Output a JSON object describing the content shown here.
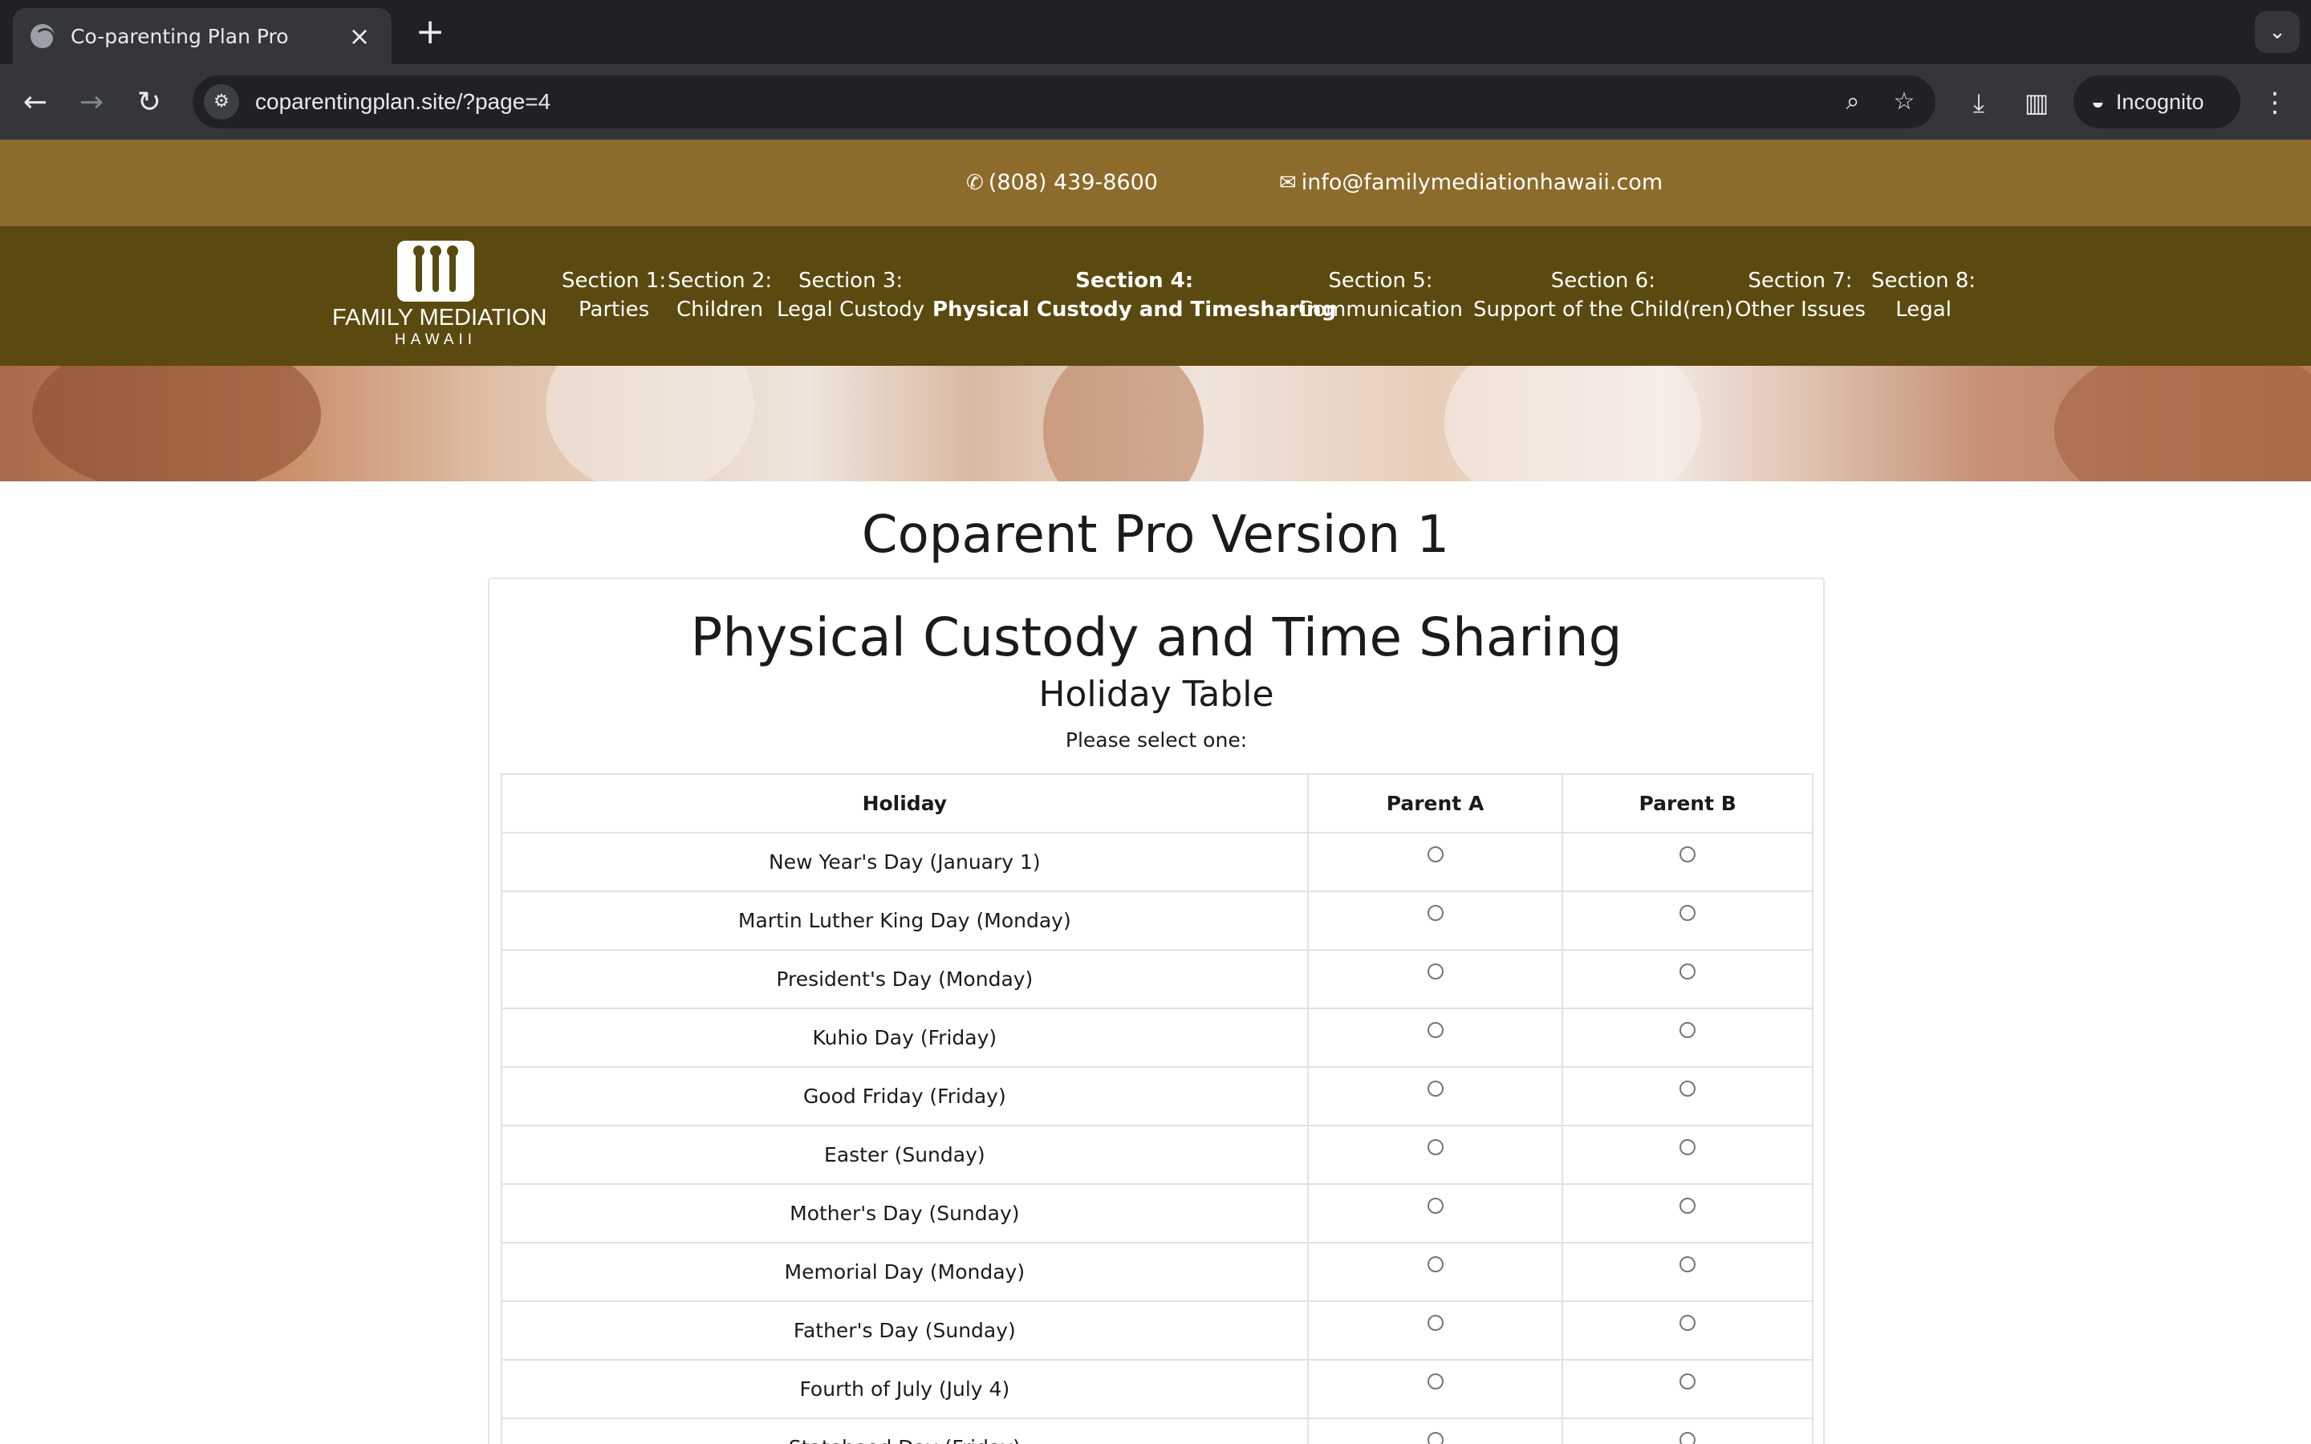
{
  "browser": {
    "tab_title": "Co-parenting Plan Pro",
    "url": "coparentingplan.site/?page=4",
    "incognito_label": "Incognito",
    "icons": [
      "globe-icon",
      "close-icon",
      "plus-icon",
      "chevron-down-icon",
      "back-icon",
      "forward-icon",
      "reload-icon",
      "site-info-icon",
      "zoom-icon",
      "star-icon",
      "download-icon",
      "sidepanel-icon",
      "incognito-icon",
      "kebab-menu-icon"
    ]
  },
  "contact": {
    "phone": "(808) 439-8600",
    "email": "info@familymediationhawaii.com"
  },
  "logo": {
    "line1": "FAMILY MEDIATION",
    "line2": "HAWAII"
  },
  "nav": [
    {
      "line1": "Section 1:",
      "line2": "Parties"
    },
    {
      "line1": "Section 2:",
      "line2": "Children"
    },
    {
      "line1": "Section 3:",
      "line2": "Legal Custody"
    },
    {
      "line1": "Section 4:",
      "line2": "Physical Custody and Timesharing",
      "active": true
    },
    {
      "line1": "Section 5:",
      "line2": "Communication"
    },
    {
      "line1": "Section 6:",
      "line2": "Support of the Child(ren)"
    },
    {
      "line1": "Section 7:",
      "line2": "Other Issues"
    },
    {
      "line1": "Section 8:",
      "line2": "Legal"
    }
  ],
  "page": {
    "title": "Coparent Pro Version 1",
    "section_title": "Physical Custody and Time Sharing",
    "subtitle": "Holiday Table",
    "instruction": "Please select one:"
  },
  "table": {
    "headers": [
      "Holiday",
      "Parent A",
      "Parent B"
    ],
    "rows": [
      "New Year's Day (January 1)",
      "Martin Luther King Day (Monday)",
      "President's Day (Monday)",
      "Kuhio Day (Friday)",
      "Good Friday (Friday)",
      "Easter (Sunday)",
      "Mother's Day (Sunday)",
      "Memorial Day (Monday)",
      "Father's Day (Sunday)",
      "Fourth of July (July 4)",
      "Statehood Day (Friday)"
    ]
  },
  "colors": {
    "contact_bar": "#8c6b2b",
    "nav_bar": "#5b4a10",
    "browser_dark": "#202124",
    "browser_toolbar": "#35363a"
  }
}
